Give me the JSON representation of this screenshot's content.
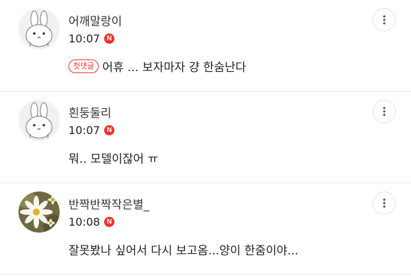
{
  "comments": [
    {
      "author": "어깨말랑이",
      "time": "10:07",
      "new_badge": "N",
      "first_badge": "첫댓글",
      "text": "어휴 ... 보자마자 걍 한숨난다",
      "avatar": "rabbit-avatar"
    },
    {
      "author": "흰둥둘리",
      "time": "10:07",
      "new_badge": "N",
      "text": "뭐.. 모델이잖어 ㅠ",
      "avatar": "rabbit-avatar"
    },
    {
      "author": "반짝반짝작은별_",
      "time": "10:08",
      "new_badge": "N",
      "text": "잘못봤나 싶어서 다시 보고옴...양이 한줌이야...",
      "avatar": "daisy-photo-avatar"
    }
  ],
  "icons": {
    "more": "more-vertical-icon"
  },
  "colors": {
    "accent": "#e8342f",
    "divider": "#ececec",
    "text": "#222222",
    "author": "#333333"
  }
}
